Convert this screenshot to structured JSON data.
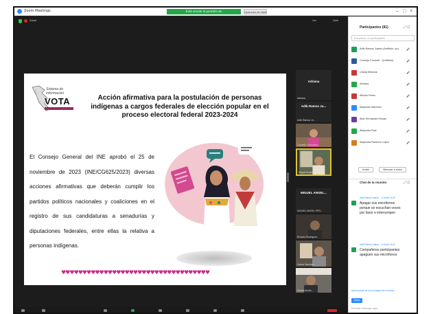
{
  "window": {
    "app_title": "Zoom Meetings",
    "share_banner": "Está viendo la pantalla de",
    "stop_share": "Opciones de vista",
    "minimize": "–",
    "maximize": "□",
    "close": "×"
  },
  "meeting": {
    "label": "Zoom",
    "view_button": "Ver",
    "fullscreen_button": "Salir"
  },
  "slide": {
    "logo_line1": "Sistema de",
    "logo_line2": "Información",
    "logo_word": "VOTA",
    "title": "Acción afirmativa para la postulación de personas indígenas a cargos federales de elección popular en el proceso electoral federal 2023-2024",
    "body": "El Consejo General del INE aprobó el 25 de noviembre de 2023 (INE/CG625/2023) diversas acciones afirmativas que deberán cumplir los partidos políticos nacionales y coaliciones en el registro de sus candidaturas a senadurías y diputaciones federales, entre ellas la relativa a personas indígenas.",
    "hearts": "♥♥♥♥♥♥♥♥♥♥♥♥♥♥♥♥♥♥♥♥♥♥♥♥♥♥♥♥♥♥♥♥♥♥♥"
  },
  "video_tiles": [
    {
      "name": "Adriana",
      "caption": "Adriana"
    },
    {
      "name": "Adib Ramos Ju...",
      "caption": "Adib Ramos Ju..."
    },
    {
      "name": "",
      "caption": "Consejo Consultivo..."
    },
    {
      "name": "",
      "caption": "Miguel Bonilla..."
    },
    {
      "name": "MIGUEL ANGEL...",
      "caption": "MIGUEL ANGEL PER..."
    },
    {
      "name": "",
      "caption": "Ricardo Rodriguez..."
    },
    {
      "name": "",
      "caption": "Carlos Sanchez..."
    },
    {
      "name": "",
      "caption": "Daniel Arrollo..."
    }
  ],
  "participants_panel": {
    "title": "Participantes (81)",
    "search_placeholder": "Encontrar un participante",
    "participants": [
      {
        "name": "Adib Ramos Juárez (Anfitrión, yo)",
        "color": "#1f9e5a",
        "mic": "muted"
      },
      {
        "name": "Consejo Consulti... (Anfitrión)",
        "color": "#2d5b9e",
        "mic": "muted"
      },
      {
        "name": "Liliana Miranda",
        "color": "#c23b3b",
        "mic": "on"
      },
      {
        "name": "Adriana",
        "color": "#23a849",
        "mic": "muted"
      },
      {
        "name": "Alberto Pérez",
        "color": "#c23b3b",
        "mic": "muted"
      },
      {
        "name": "Alejandro Martínez",
        "color": "#2d8cff",
        "mic": "muted"
      },
      {
        "name": "Aldo Hernández Rosas",
        "color": "#6b3fa0",
        "mic": "muted"
      },
      {
        "name": "Alejandra Ruiz",
        "color": "#23a849",
        "mic": "muted"
      },
      {
        "name": "Alejandra Ramírez López",
        "color": "#d17f1e",
        "mic": "muted"
      }
    ],
    "invite_button": "Invitar",
    "mute_all_button": "Silenciar a todos"
  },
  "chat": {
    "title": "Chat de la reunión",
    "messages": [
      {
        "meta": "Adib Ramos Juárez ... a Todos 11:00",
        "text": "Apagar sus micrófonos porque se escuchan voces por favor e interrumpen"
      },
      {
        "meta": "Adib Ramos Juárez ... a Todos 11:02",
        "text": "Compañeros participantes apaguen sus micrófonos"
      }
    ],
    "footer": "Quién puede ver los mensajes de la reunión",
    "to_button": "Todos",
    "input_placeholder": "Escribir mensaje aquí..."
  }
}
